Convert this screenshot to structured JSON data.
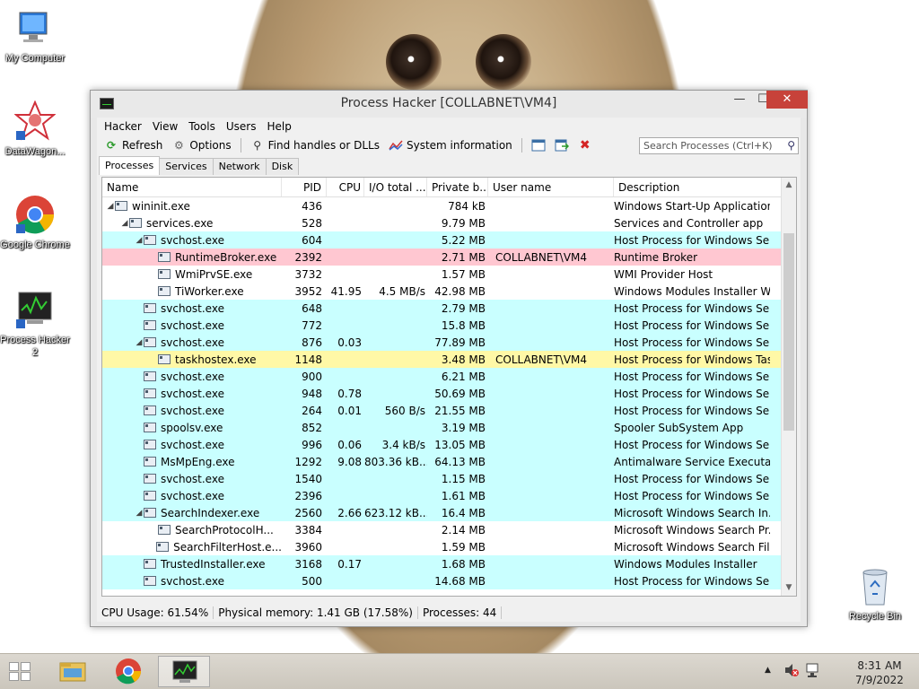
{
  "desktop": {
    "icons": [
      {
        "label": "My Computer"
      },
      {
        "label": "DataWagon..."
      },
      {
        "label": "Google Chrome"
      },
      {
        "label": "Process Hacker 2"
      },
      {
        "label": "Recycle Bin"
      }
    ]
  },
  "window": {
    "title": "Process Hacker [COLLABNET\\VM4]",
    "min_glyph": "—",
    "max_glyph": "☐",
    "close_glyph": "✕"
  },
  "menu": [
    "Hacker",
    "View",
    "Tools",
    "Users",
    "Help"
  ],
  "toolbar": {
    "refresh": "Refresh",
    "options": "Options",
    "find_handles": "Find handles or DLLs",
    "system_info": "System information",
    "search_placeholder": "Search Processes (Ctrl+K)"
  },
  "tabs": [
    "Processes",
    "Services",
    "Network",
    "Disk"
  ],
  "columns": [
    "Name",
    "PID",
    "CPU",
    "I/O total ...",
    "Private b...",
    "User name",
    "Description"
  ],
  "processes": [
    {
      "name": "wininit.exe",
      "indent": 0,
      "expanded": true,
      "pid": "436",
      "cpu": "",
      "io": "",
      "priv": "784 kB",
      "user": "",
      "desc": "Windows Start-Up Application",
      "bg": "white"
    },
    {
      "name": "services.exe",
      "indent": 1,
      "expanded": true,
      "pid": "528",
      "cpu": "",
      "io": "",
      "priv": "9.79 MB",
      "user": "",
      "desc": "Services and Controller app",
      "bg": "white"
    },
    {
      "name": "svchost.exe",
      "indent": 2,
      "expanded": true,
      "pid": "604",
      "cpu": "",
      "io": "",
      "priv": "5.22 MB",
      "user": "",
      "desc": "Host Process for Windows Ser...",
      "bg": "cyan"
    },
    {
      "name": "RuntimeBroker.exe",
      "indent": 3,
      "expanded": false,
      "pid": "2392",
      "cpu": "",
      "io": "",
      "priv": "2.71 MB",
      "user": "COLLABNET\\VM4",
      "desc": "Runtime Broker",
      "bg": "pink"
    },
    {
      "name": "WmiPrvSE.exe",
      "indent": 3,
      "expanded": false,
      "pid": "3732",
      "cpu": "",
      "io": "",
      "priv": "1.57 MB",
      "user": "",
      "desc": "WMI Provider Host",
      "bg": "white"
    },
    {
      "name": "TiWorker.exe",
      "indent": 3,
      "expanded": false,
      "pid": "3952",
      "cpu": "41.95",
      "io": "4.5 MB/s",
      "priv": "42.98 MB",
      "user": "",
      "desc": "Windows Modules Installer W...",
      "bg": "white"
    },
    {
      "name": "svchost.exe",
      "indent": 2,
      "expanded": false,
      "pid": "648",
      "cpu": "",
      "io": "",
      "priv": "2.79 MB",
      "user": "",
      "desc": "Host Process for Windows Ser...",
      "bg": "cyan"
    },
    {
      "name": "svchost.exe",
      "indent": 2,
      "expanded": false,
      "pid": "772",
      "cpu": "",
      "io": "",
      "priv": "15.8 MB",
      "user": "",
      "desc": "Host Process for Windows Ser...",
      "bg": "cyan"
    },
    {
      "name": "svchost.exe",
      "indent": 2,
      "expanded": true,
      "pid": "876",
      "cpu": "0.03",
      "io": "",
      "priv": "77.89 MB",
      "user": "",
      "desc": "Host Process for Windows Ser...",
      "bg": "cyan"
    },
    {
      "name": "taskhostex.exe",
      "indent": 3,
      "expanded": false,
      "pid": "1148",
      "cpu": "",
      "io": "",
      "priv": "3.48 MB",
      "user": "COLLABNET\\VM4",
      "desc": "Host Process for Windows Tas...",
      "bg": "yellow"
    },
    {
      "name": "svchost.exe",
      "indent": 2,
      "expanded": false,
      "pid": "900",
      "cpu": "",
      "io": "",
      "priv": "6.21 MB",
      "user": "",
      "desc": "Host Process for Windows Ser...",
      "bg": "cyan"
    },
    {
      "name": "svchost.exe",
      "indent": 2,
      "expanded": false,
      "pid": "948",
      "cpu": "0.78",
      "io": "",
      "priv": "50.69 MB",
      "user": "",
      "desc": "Host Process for Windows Ser...",
      "bg": "cyan"
    },
    {
      "name": "svchost.exe",
      "indent": 2,
      "expanded": false,
      "pid": "264",
      "cpu": "0.01",
      "io": "560 B/s",
      "priv": "21.55 MB",
      "user": "",
      "desc": "Host Process for Windows Ser...",
      "bg": "cyan"
    },
    {
      "name": "spoolsv.exe",
      "indent": 2,
      "expanded": false,
      "pid": "852",
      "cpu": "",
      "io": "",
      "priv": "3.19 MB",
      "user": "",
      "desc": "Spooler SubSystem App",
      "bg": "cyan"
    },
    {
      "name": "svchost.exe",
      "indent": 2,
      "expanded": false,
      "pid": "996",
      "cpu": "0.06",
      "io": "3.4 kB/s",
      "priv": "13.05 MB",
      "user": "",
      "desc": "Host Process for Windows Ser...",
      "bg": "cyan"
    },
    {
      "name": "MsMpEng.exe",
      "indent": 2,
      "expanded": false,
      "pid": "1292",
      "cpu": "9.08",
      "io": "803.36 kB...",
      "priv": "64.13 MB",
      "user": "",
      "desc": "Antimalware Service Executable",
      "bg": "cyan"
    },
    {
      "name": "svchost.exe",
      "indent": 2,
      "expanded": false,
      "pid": "1540",
      "cpu": "",
      "io": "",
      "priv": "1.15 MB",
      "user": "",
      "desc": "Host Process for Windows Ser...",
      "bg": "cyan"
    },
    {
      "name": "svchost.exe",
      "indent": 2,
      "expanded": false,
      "pid": "2396",
      "cpu": "",
      "io": "",
      "priv": "1.61 MB",
      "user": "",
      "desc": "Host Process for Windows Ser...",
      "bg": "cyan"
    },
    {
      "name": "SearchIndexer.exe",
      "indent": 2,
      "expanded": true,
      "pid": "2560",
      "cpu": "2.66",
      "io": "623.12 kB...",
      "priv": "16.4 MB",
      "user": "",
      "desc": "Microsoft Windows Search In...",
      "bg": "cyan"
    },
    {
      "name": "SearchProtocolH...",
      "indent": 3,
      "expanded": false,
      "pid": "3384",
      "cpu": "",
      "io": "",
      "priv": "2.14 MB",
      "user": "",
      "desc": "Microsoft Windows Search Pr...",
      "bg": "white"
    },
    {
      "name": "SearchFilterHost.e...",
      "indent": 3,
      "expanded": false,
      "pid": "3960",
      "cpu": "",
      "io": "",
      "priv": "1.59 MB",
      "user": "",
      "desc": "Microsoft Windows Search Fil...",
      "bg": "white"
    },
    {
      "name": "TrustedInstaller.exe",
      "indent": 2,
      "expanded": false,
      "pid": "3168",
      "cpu": "0.17",
      "io": "",
      "priv": "1.68 MB",
      "user": "",
      "desc": "Windows Modules Installer",
      "bg": "cyan"
    },
    {
      "name": "svchost.exe",
      "indent": 2,
      "expanded": false,
      "pid": "500",
      "cpu": "",
      "io": "",
      "priv": "14.68 MB",
      "user": "",
      "desc": "Host Process for Windows Ser...",
      "bg": "cyan"
    }
  ],
  "status": {
    "cpu": "CPU Usage: 61.54%",
    "memory": "Physical memory: 1.41 GB (17.58%)",
    "processes": "Processes: 44"
  },
  "taskbar": {
    "time": "8:31 AM",
    "date": "7/9/2022"
  }
}
